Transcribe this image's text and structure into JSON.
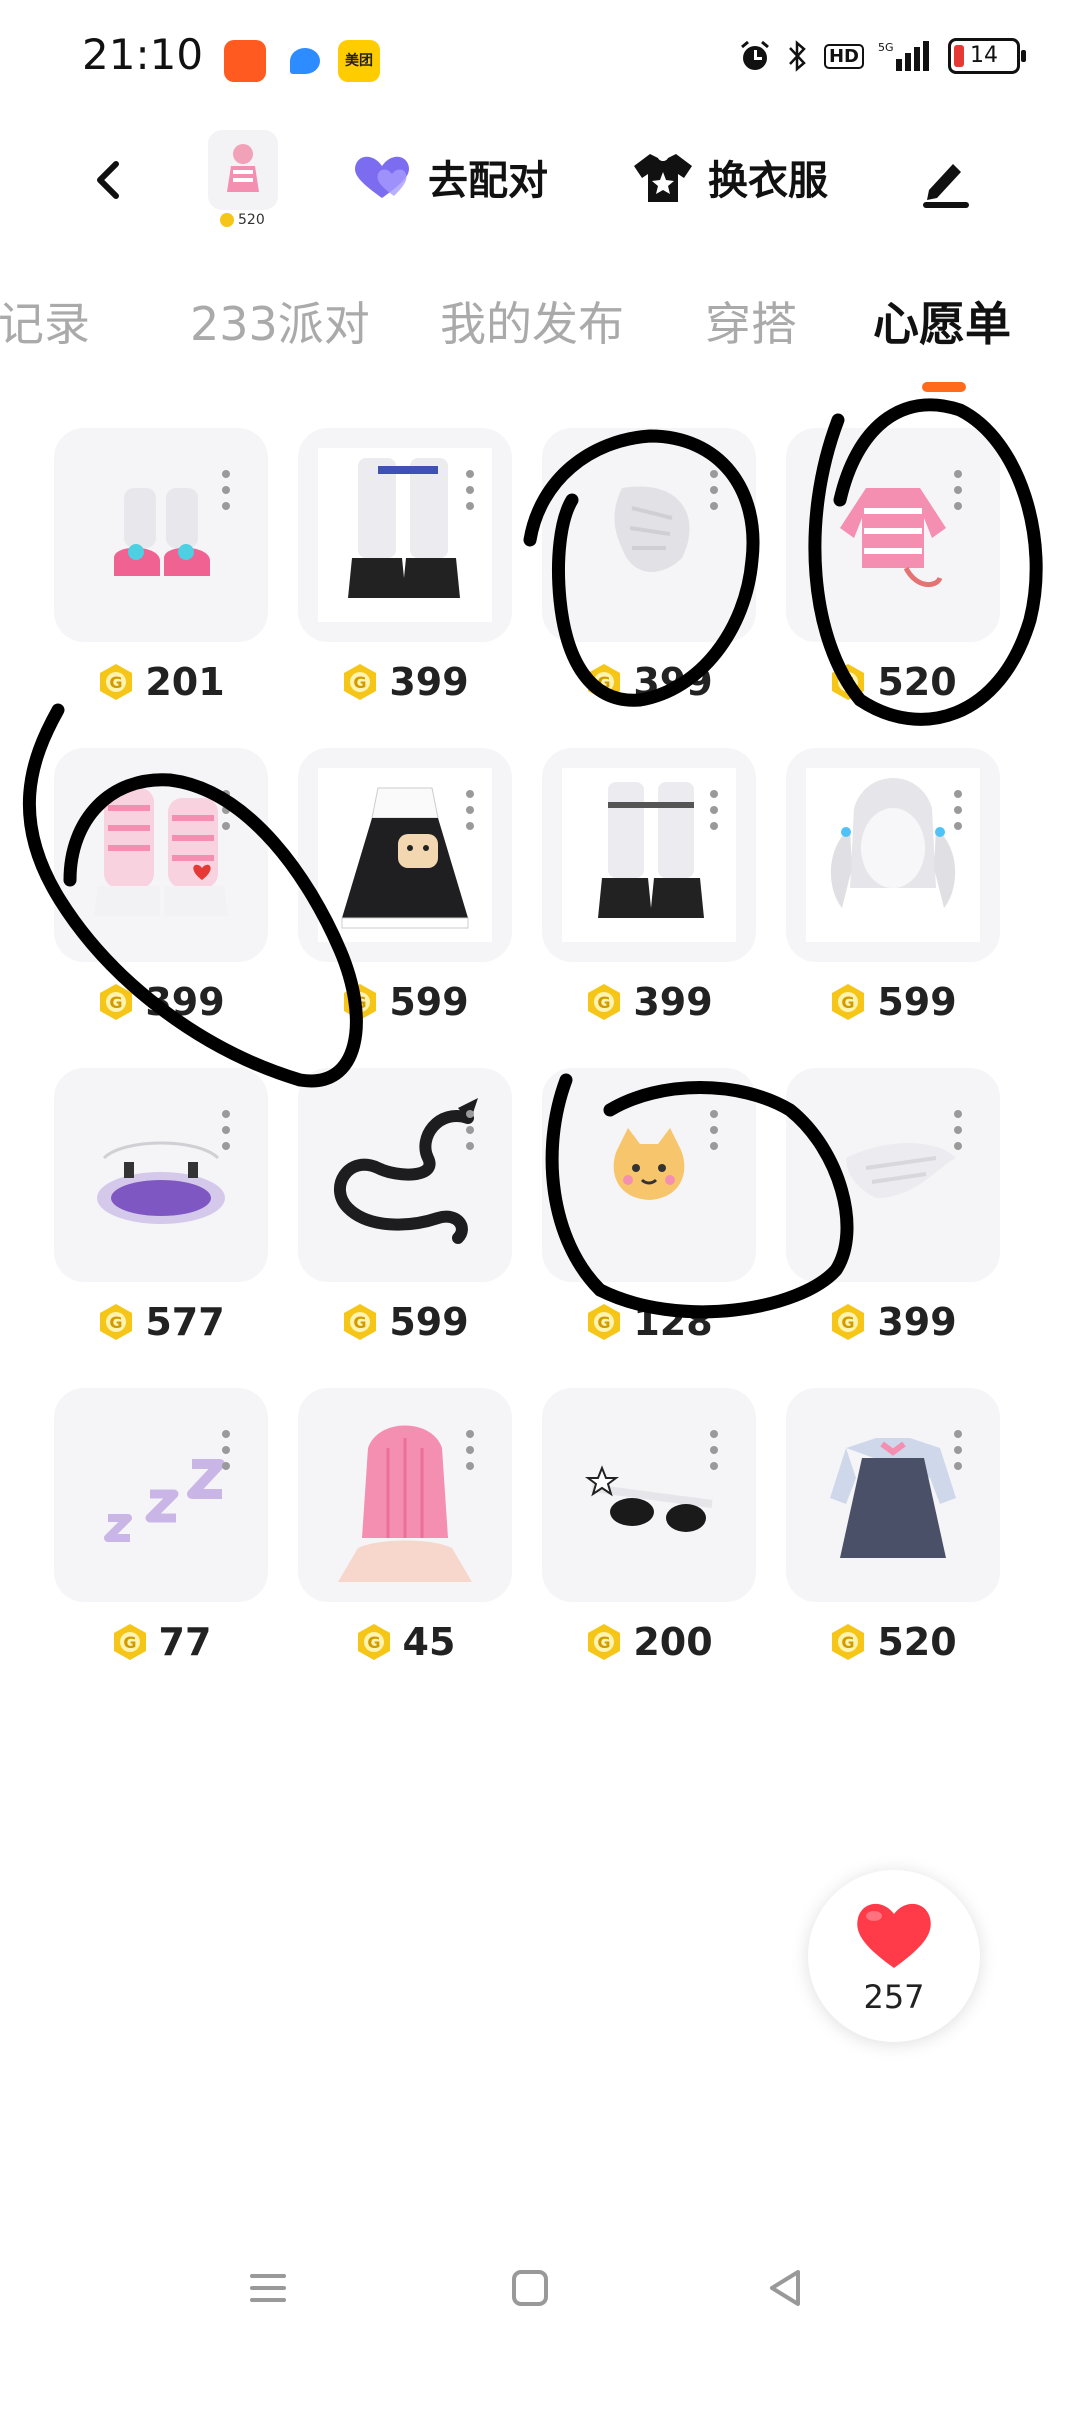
{
  "status": {
    "time": "21:10",
    "apps": [
      "kuaishou-icon",
      "browser-icon",
      "meituan-icon"
    ],
    "meituan_label": "美团",
    "hd": "HD",
    "network": "5G",
    "battery": "14"
  },
  "nav": {
    "avatar_price": "520",
    "pair_label": "去配对",
    "dress_label": "换衣服"
  },
  "tabs": [
    "我记录",
    "233派对",
    "我的发布",
    "穿搭",
    "心愿单"
  ],
  "active_tab": "心愿单",
  "items": [
    {
      "icon": "pink-sandals",
      "price": "201"
    },
    {
      "icon": "white-leg-warmer-boots",
      "price": "399"
    },
    {
      "icon": "white-feather-wing",
      "price": "399"
    },
    {
      "icon": "pink-jacket-with-tail",
      "price": "520"
    },
    {
      "icon": "pink-striped-boots",
      "price": "399"
    },
    {
      "icon": "black-dress-with-bag",
      "price": "599"
    },
    {
      "icon": "white-boots",
      "price": "399"
    },
    {
      "icon": "white-twin-tail-hair",
      "price": "599"
    },
    {
      "icon": "purple-magic-circle",
      "price": "577"
    },
    {
      "icon": "black-dragon",
      "price": "599"
    },
    {
      "icon": "cat-toast",
      "price": "128"
    },
    {
      "icon": "white-wing",
      "price": "399"
    },
    {
      "icon": "zzz-sleep",
      "price": "77"
    },
    {
      "icon": "pink-hair",
      "price": "45"
    },
    {
      "icon": "star-sunglasses",
      "price": "200"
    },
    {
      "icon": "navy-dress",
      "price": "520"
    }
  ],
  "like": {
    "count": "257"
  },
  "colors": {
    "accent": "#ff6b1a",
    "coin": "#f5c518",
    "heart": "#ff3b4a",
    "pair_icon": "#7b6cf0"
  }
}
